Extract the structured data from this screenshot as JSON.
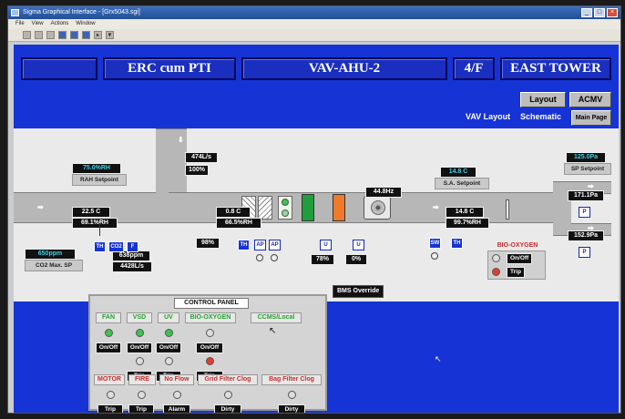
{
  "window": {
    "title": "Sigma Graphical Interface - [Grx5043.sgi]",
    "buttons": [
      "_",
      "□",
      "×"
    ]
  },
  "menu": [
    "File",
    "View",
    "Actions",
    "Window"
  ],
  "toolbar_icons": [
    "print-icon",
    "save-icon",
    "open-icon",
    "blue-icon-1",
    "blue-icon-2",
    "blue-icon-3",
    "blue-icon-4",
    "filter-icon"
  ],
  "header": {
    "site": "ERC cum PTI",
    "unit": "VAV-AHU-2",
    "floor": "4/F",
    "tower": "EAST TOWER"
  },
  "nav": {
    "layout": "Layout",
    "acmv": "ACMV",
    "vav_layout": "VAV Layout",
    "schematic": "Schematic",
    "main_page": "Main Page"
  },
  "readings": {
    "rah_rh": "75.0%RH",
    "rah_setpoint": "RAH Setpoint",
    "ra_flow": "474L/s",
    "ra_damper": "100%",
    "ra_temp": "22.5 C",
    "ra_rh": "69.1%RH",
    "co2_ppm": "650ppm",
    "co2_max_sp": "CO2 Max. SP",
    "co2_reading": "638ppm",
    "oa_flow": "4428L/s",
    "oa_damper": "98%",
    "mix_temp": "0.8 C",
    "mix_rh": "66.5%RH",
    "chw_valve": "78%",
    "hw_valve": "0%",
    "vsd_hz": "44.8Hz",
    "sa_temp_sp": "14.8 C",
    "sa_setpoint": "S.A. Setpoint",
    "sa_temp": "14.8 C",
    "sa_rh": "99.7%RH",
    "sp_top": "125.0Pa",
    "sp_setpoint": "SP Setpoint",
    "sp_1": "171.1Pa",
    "sp_2": "152.9Pa"
  },
  "sensors": {
    "th": "TH",
    "co2": "CO2",
    "f": "F",
    "ap": "AP",
    "u": "U",
    "sw": "SW",
    "p": "P"
  },
  "bio_oxygen": {
    "title": "BIO-OXYGEN",
    "status": "On/Off",
    "alarm": "Trip"
  },
  "bms_override": "BMS Override",
  "control_panel": {
    "title": "CONTROL PANEL",
    "row1": [
      {
        "name": "FAN",
        "led": "green",
        "tag": "On/Off"
      },
      {
        "name": "VSD",
        "led": "green",
        "tag": "On/Off",
        "led2": "off",
        "tag2": "Trip"
      },
      {
        "name": "UV",
        "led": "green",
        "tag": "On/Off",
        "led2": "off",
        "tag2": "Trip"
      },
      {
        "name": "BIO-OXYGEN",
        "led": "off",
        "tag": "On/Off",
        "led2": "red",
        "tag2": "Trip"
      },
      {
        "name": "CCMS/Local"
      }
    ],
    "row2": [
      {
        "name": "MOTOR",
        "led": "off",
        "tag": "Trip"
      },
      {
        "name": "FIRE",
        "led": "off",
        "tag": "Trip"
      },
      {
        "name": "No Flow",
        "led": "off",
        "tag": "Alarm"
      },
      {
        "name": "Grid Filter Clog",
        "led": "off",
        "tag": "Dirty"
      },
      {
        "name": "Bag Filter Clog",
        "led": "off",
        "tag": "Dirty"
      }
    ]
  },
  "colors": {
    "background": "#1633d6",
    "duct": "#b7b7b7",
    "readout_bg": "#111111",
    "readout_text_cyan": "#3fd0e8",
    "coil_green": "#1f9e3c",
    "coil_orange": "#f07a2a"
  }
}
